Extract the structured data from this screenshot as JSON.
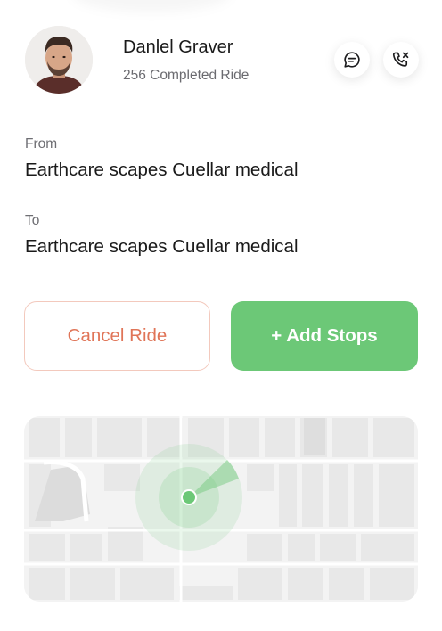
{
  "driver": {
    "name": "Danlel Graver",
    "rides": "256 Completed Ride"
  },
  "actions": {
    "message_icon": "chat-icon",
    "call_icon": "phone-call-icon"
  },
  "trip": {
    "from_label": "From",
    "from_value": "Earthcare scapes Cuellar medical",
    "to_label": "To",
    "to_value": "Earthcare scapes Cuellar medical"
  },
  "buttons": {
    "cancel": "Cancel Ride",
    "add": "+ Add Stops"
  },
  "colors": {
    "accent_green": "#6cc877",
    "cancel_text": "#e07558",
    "cancel_border": "#f3c9bd"
  }
}
